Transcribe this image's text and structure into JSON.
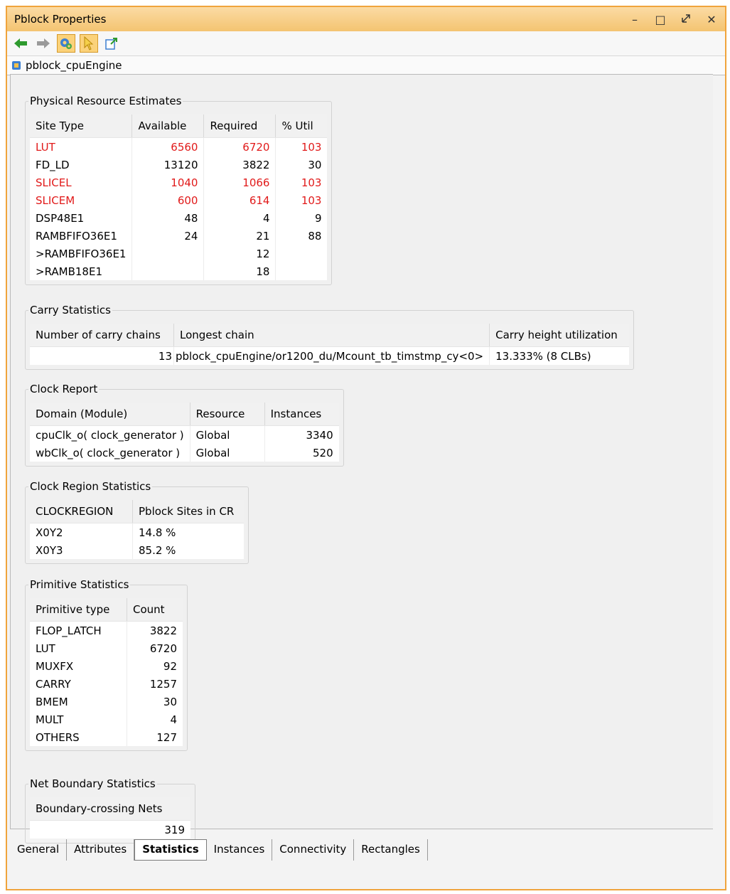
{
  "window": {
    "title": "Pblock Properties"
  },
  "breadcrumb": {
    "label": "pblock_cpuEngine"
  },
  "physical": {
    "legend": "Physical Resource Estimates",
    "headers": [
      "Site Type",
      "Available",
      "Required",
      "% Util"
    ],
    "rows": [
      [
        "LUT",
        "6560",
        "6720",
        "103"
      ],
      [
        "FD_LD",
        "13120",
        "3822",
        "30"
      ],
      [
        "SLICEL",
        "1040",
        "1066",
        "103"
      ],
      [
        "SLICEM",
        "600",
        "614",
        "103"
      ],
      [
        "DSP48E1",
        "48",
        "4",
        "9"
      ],
      [
        "RAMBFIFO36E1",
        "24",
        "21",
        "88"
      ],
      [
        ">RAMBFIFO36E1",
        "",
        "12",
        ""
      ],
      [
        ">RAMB18E1",
        "",
        "18",
        ""
      ]
    ],
    "highlight_color": "#e11a1a"
  },
  "carry": {
    "legend": "Carry Statistics",
    "headers": [
      "Number of carry chains",
      "Longest chain",
      "Carry height utilization"
    ],
    "rows": [
      [
        "13",
        "pblock_cpuEngine/or1200_du/Mcount_tb_timstmp_cy<0>",
        "13.333% (8 CLBs)"
      ]
    ]
  },
  "clock": {
    "legend": "Clock Report",
    "headers": [
      "Domain (Module)",
      "Resource",
      "Instances"
    ],
    "rows": [
      [
        "cpuClk_o( clock_generator )",
        "Global",
        "3340"
      ],
      [
        "wbClk_o( clock_generator )",
        "Global",
        "520"
      ]
    ]
  },
  "region": {
    "legend": "Clock Region Statistics",
    "headers": [
      "CLOCKREGION",
      "Pblock Sites in CR"
    ],
    "rows": [
      [
        "X0Y2",
        "14.8 %"
      ],
      [
        "X0Y3",
        "85.2 %"
      ]
    ]
  },
  "primitive": {
    "legend": "Primitive Statistics",
    "headers": [
      "Primitive type",
      "Count"
    ],
    "rows": [
      [
        "FLOP_LATCH",
        "3822"
      ],
      [
        "LUT",
        "6720"
      ],
      [
        "MUXFX",
        "92"
      ],
      [
        "CARRY",
        "1257"
      ],
      [
        "BMEM",
        "30"
      ],
      [
        "MULT",
        "4"
      ],
      [
        "OTHERS",
        "127"
      ]
    ]
  },
  "net": {
    "legend": "Net Boundary Statistics",
    "headers": [
      "Boundary-crossing Nets"
    ],
    "rows": [
      [
        "319"
      ]
    ]
  },
  "tabs": [
    "General",
    "Attributes",
    "Statistics",
    "Instances",
    "Connectivity",
    "Rectangles"
  ],
  "active_tab": "Statistics"
}
